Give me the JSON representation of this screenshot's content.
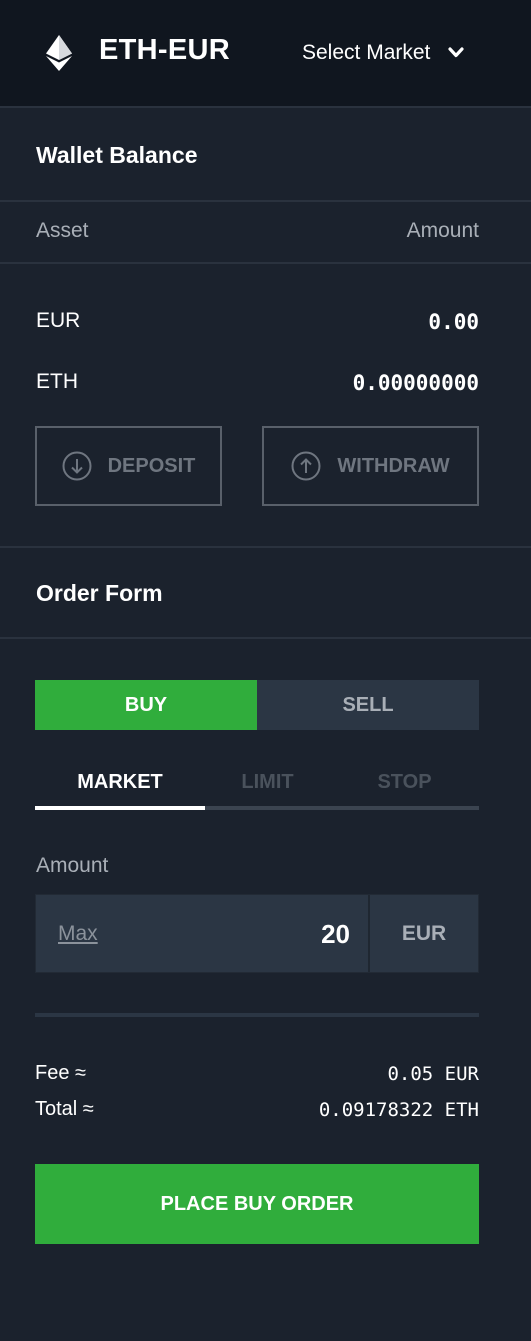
{
  "header": {
    "pair": "ETH-EUR",
    "select_market_label": "Select Market",
    "logo_icon": "ethereum-icon",
    "chevron_icon": "chevron-down-icon"
  },
  "wallet": {
    "title": "Wallet Balance",
    "columns": {
      "asset": "Asset",
      "amount": "Amount"
    },
    "balances": [
      {
        "asset": "EUR",
        "amount": "0.00"
      },
      {
        "asset": "ETH",
        "amount": "0.00000000"
      }
    ],
    "deposit_label": "DEPOSIT",
    "withdraw_label": "WITHDRAW",
    "deposit_icon": "arrow-down-circle-icon",
    "withdraw_icon": "arrow-up-circle-icon"
  },
  "order_form": {
    "title": "Order Form",
    "sides": {
      "buy": "BUY",
      "sell": "SELL",
      "active": "buy"
    },
    "types": {
      "market": "MARKET",
      "limit": "LIMIT",
      "stop": "STOP",
      "active": "market"
    },
    "amount_label": "Amount",
    "max_label": "Max",
    "amount_value": "20",
    "currency": "EUR",
    "fee": {
      "label": "Fee ≈",
      "value": "0.05 EUR"
    },
    "total": {
      "label": "Total ≈",
      "value": "0.09178322 ETH"
    },
    "place_order_label": "PLACE BUY ORDER"
  },
  "colors": {
    "background": "#1b222d",
    "header_bg": "#10161f",
    "accent_green": "#30ad3c",
    "panel": "#2b3644",
    "muted_text": "#a9afb7"
  }
}
